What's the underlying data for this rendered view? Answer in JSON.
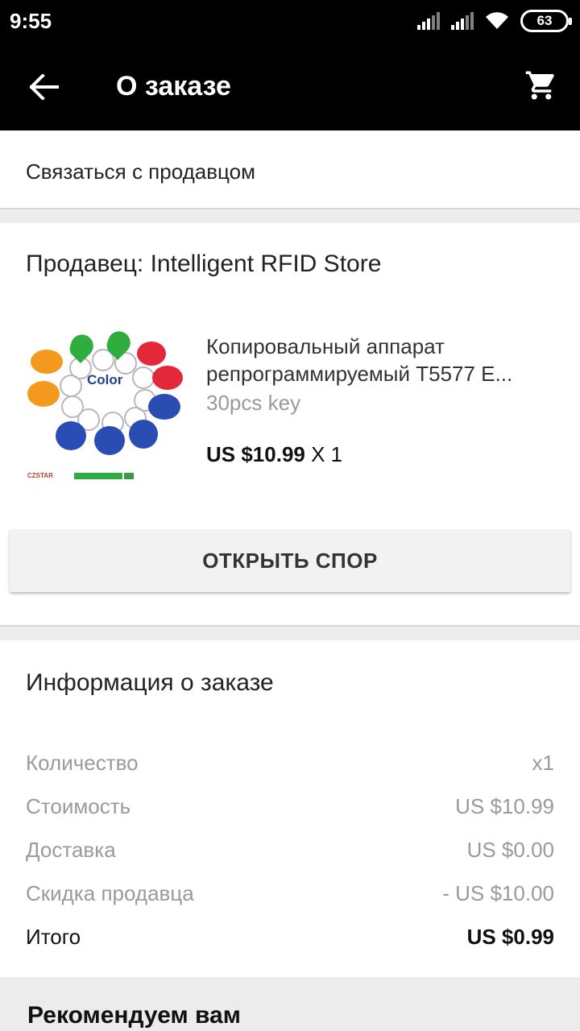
{
  "status_bar": {
    "time": "9:55",
    "battery": "63"
  },
  "app_bar": {
    "title": "О заказе"
  },
  "contact": {
    "label": "Связаться с продавцом"
  },
  "seller": {
    "label": "Продавец: Intelligent RFID Store"
  },
  "product": {
    "title_line1": "Копировальный аппарат",
    "title_line2": "репрограммируемый T5577 E...",
    "variant": "30pcs key",
    "price": "US $10.99",
    "quantity": "X 1",
    "image_text": "Color",
    "image_footer": "CZSTAR"
  },
  "dispute_button": {
    "label": "ОТКРЫТЬ СПОР"
  },
  "order_info": {
    "title": "Информация о заказе",
    "rows": [
      {
        "label": "Количество",
        "value": "x1"
      },
      {
        "label": "Стоимость",
        "value": "US $10.99"
      },
      {
        "label": "Доставка",
        "value": "US $0.00"
      },
      {
        "label": "Скидка продавца",
        "value": "- US $10.00"
      }
    ],
    "total": {
      "label": "Итого",
      "value": "US $0.99"
    }
  },
  "recommend": {
    "title": "Рекомендуем вам"
  },
  "colors": {
    "bar": "#000000",
    "divider": "#ececec",
    "muted_text": "#9a9a9a",
    "button_bg": "#f2f2f2"
  }
}
